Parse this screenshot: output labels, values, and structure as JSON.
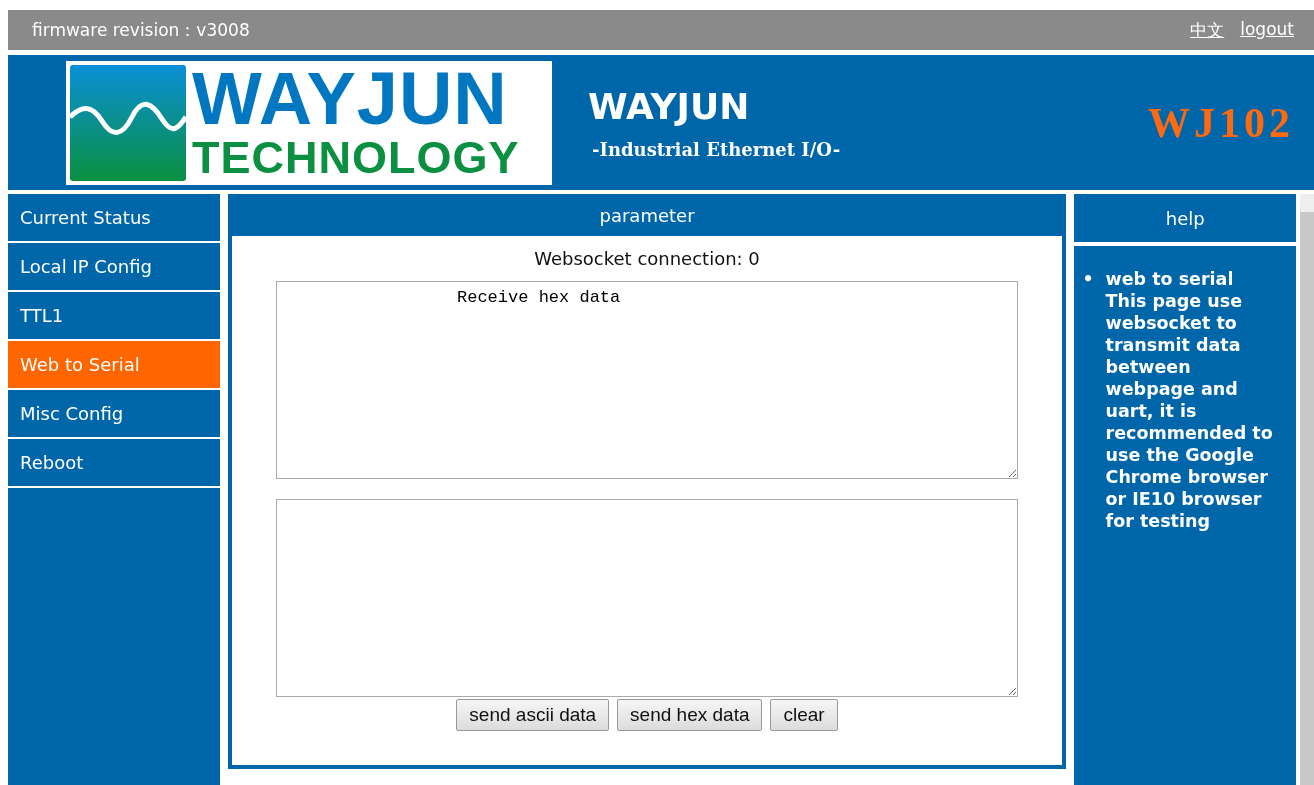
{
  "top_bar": {
    "firmware": "firmware revision：v3008",
    "links": [
      {
        "label": "中文"
      },
      {
        "label": "logout"
      }
    ]
  },
  "header": {
    "logo": {
      "name": "WAYJUN",
      "tagline": "TECHNOLOGY"
    },
    "title": "WAYJUN",
    "subtitle": "-Industrial Ethernet I/O-",
    "model": "WJ102"
  },
  "sidebar": {
    "items": [
      {
        "label": "Current Status",
        "selected": false
      },
      {
        "label": "Local IP Config",
        "selected": false
      },
      {
        "label": "TTL1",
        "selected": false
      },
      {
        "label": "Web to Serial",
        "selected": true
      },
      {
        "label": "Misc Config",
        "selected": false
      },
      {
        "label": "Reboot",
        "selected": false
      }
    ]
  },
  "parameter": {
    "title": "parameter",
    "connection": "Websocket connection: 0",
    "receive_box": {
      "value": "Receive hex data"
    },
    "buttons": [
      {
        "label": "send ascii data"
      },
      {
        "label": "send hex data"
      },
      {
        "label": "clear"
      }
    ]
  },
  "help": {
    "title": "help",
    "items": [
      {
        "marker": "•",
        "title": "web to serial",
        "text": "This page use websocket to transmit data between webpage and uart, it is recommended to use the Google Chrome browser or IE10 browser for testing"
      }
    ]
  }
}
